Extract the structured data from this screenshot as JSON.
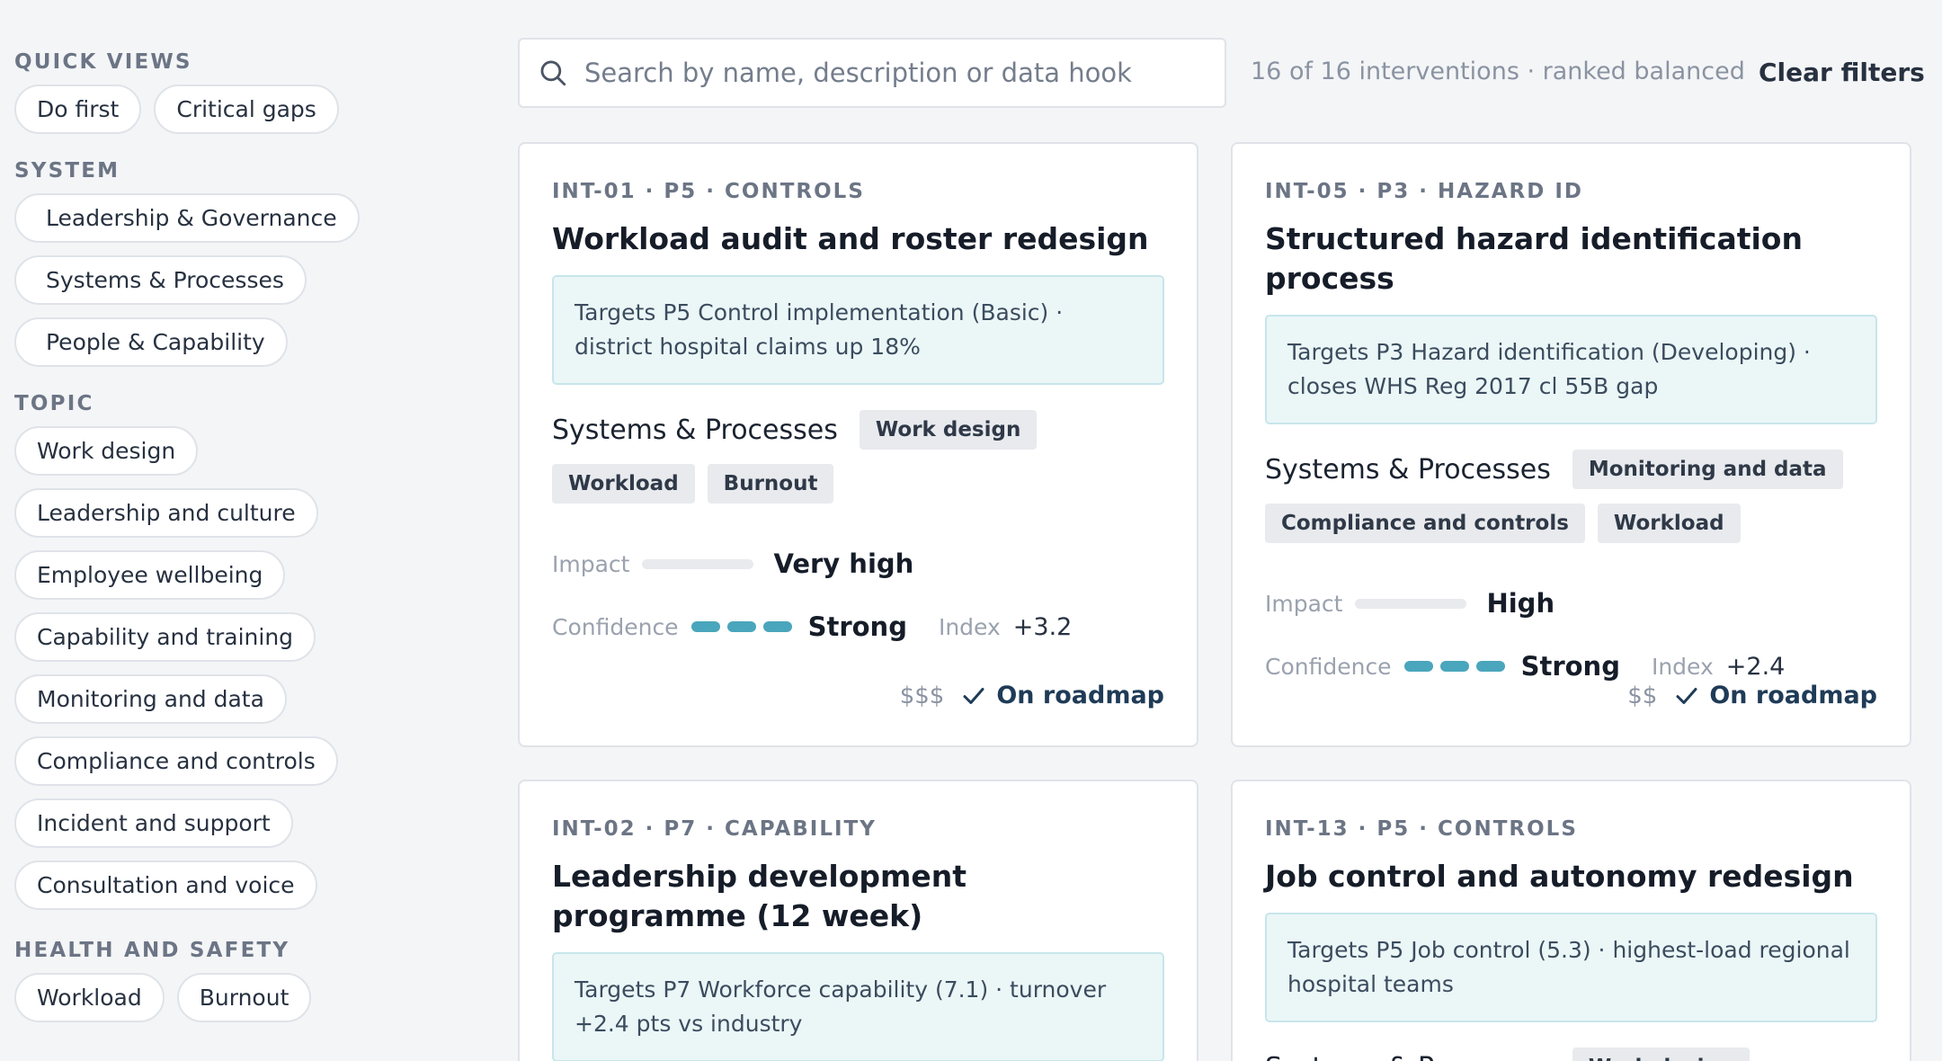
{
  "sidebar": {
    "quick_views": {
      "title": "QUICK VIEWS",
      "items": [
        "Do first",
        "Critical gaps"
      ]
    },
    "system": {
      "title": "SYSTEM",
      "items": [
        "Leadership & Governance",
        "Systems & Processes",
        "People & Capability"
      ]
    },
    "topic": {
      "title": "TOPIC",
      "items": [
        "Work design",
        "Leadership and culture",
        "Employee wellbeing",
        "Capability and training",
        "Monitoring and data",
        "Compliance and controls",
        "Incident and support",
        "Consultation and voice"
      ]
    },
    "health_safety": {
      "title": "HEALTH AND SAFETY",
      "items": [
        "Workload",
        "Burnout"
      ]
    }
  },
  "search": {
    "placeholder": "Search by name, description or data hook",
    "icon": "search-icon"
  },
  "results_count": "16 of 16 interventions · ranked balanced",
  "clear_filters": "Clear filters",
  "colors": {
    "accent": "#4aa6bc",
    "target_bg": "#ebf6f7",
    "tag_bg": "#e8eaee"
  },
  "cards": [
    {
      "meta": "INT-01 · P5 · CONTROLS",
      "title": "Workload audit and roster redesign",
      "target": "Targets P5 Control implementation (Basic) · district hospital claims up 18%",
      "pillar": "Systems & Processes",
      "tags": [
        "Work design",
        "Workload",
        "Burnout"
      ],
      "impact_label": "Impact",
      "impact_value": "Very high",
      "impact_level": 0,
      "confidence_label": "Confidence",
      "confidence_value": "Strong",
      "confidence_level": 3,
      "index_label": "Index",
      "index_value": "+3.2",
      "cost": "$$$",
      "status": "On roadmap"
    },
    {
      "meta": "INT-05 · P3 · HAZARD ID",
      "title": "Structured hazard identification process",
      "target": "Targets P3 Hazard identification (Developing) · closes WHS Reg 2017 cl 55B gap",
      "pillar": "Systems & Processes",
      "tags": [
        "Monitoring and data",
        "Compliance and controls",
        "Workload"
      ],
      "impact_label": "Impact",
      "impact_value": "High",
      "impact_level": 0,
      "confidence_label": "Confidence",
      "confidence_value": "Strong",
      "confidence_level": 3,
      "index_label": "Index",
      "index_value": "+2.4",
      "cost": "$$",
      "status": "On roadmap"
    },
    {
      "meta": "INT-02 · P7 · CAPABILITY",
      "title": "Leadership development programme (12 week)",
      "target": "Targets P7 Workforce capability (7.1) · turnover +2.4 pts vs industry"
    },
    {
      "meta": "INT-13 · P5 · CONTROLS",
      "title": "Job control and autonomy redesign",
      "target": "Targets P5 Job control (5.3) · highest-load regional hospital teams",
      "pillar": "Systems & Processes",
      "tags": [
        "Work design"
      ]
    }
  ]
}
